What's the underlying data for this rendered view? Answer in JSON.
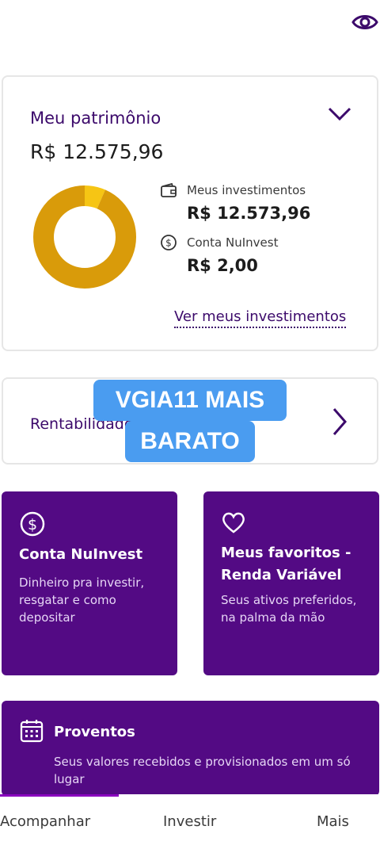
{
  "header": {
    "visibility_icon": "eye-icon"
  },
  "patrimonio": {
    "title": "Meu patrimônio",
    "total": "R$ 12.575,96",
    "expand_icon": "chevron-down-icon",
    "donut": {
      "segments": [
        {
          "name": "Meus investimentos",
          "value": 12573.96,
          "color": "#d99b0a"
        },
        {
          "name": "Conta NuInvest",
          "value": 2.0,
          "color": "#f6c514"
        }
      ]
    },
    "legend": [
      {
        "icon": "wallet-icon",
        "label": "Meus investimentos",
        "value": "R$ 12.573,96"
      },
      {
        "icon": "dollar-circle-icon",
        "label": "Conta NuInvest",
        "value": "R$ 2,00"
      }
    ],
    "link": "Ver meus investimentos"
  },
  "rentabilidade": {
    "label": "Rentabilidade",
    "arrow_icon": "chevron-right-icon"
  },
  "overlay": {
    "line1": "VGIA11 MAIS",
    "line2": "BARATO"
  },
  "cards": {
    "conta": {
      "icon": "dollar-circle-icon",
      "title": "Conta NuInvest",
      "desc": "Dinheiro pra investir, resgatar e como depositar"
    },
    "favoritos": {
      "icon": "heart-icon",
      "title": "Meus favoritos - Renda Variável",
      "desc": "Seus ativos preferidos, na palma da mão"
    },
    "proventos": {
      "icon": "calendar-icon",
      "title": "Proventos",
      "desc": "Seus valores recebidos e provisionados em um só lugar"
    }
  },
  "bottom_nav": {
    "tabs": [
      "Acompanhar",
      "Investir",
      "Mais"
    ],
    "active": 0
  },
  "colors": {
    "brand_purple": "#530a84",
    "title_purple": "#3c0a6b",
    "overlay_blue": "#4a9cf0"
  }
}
